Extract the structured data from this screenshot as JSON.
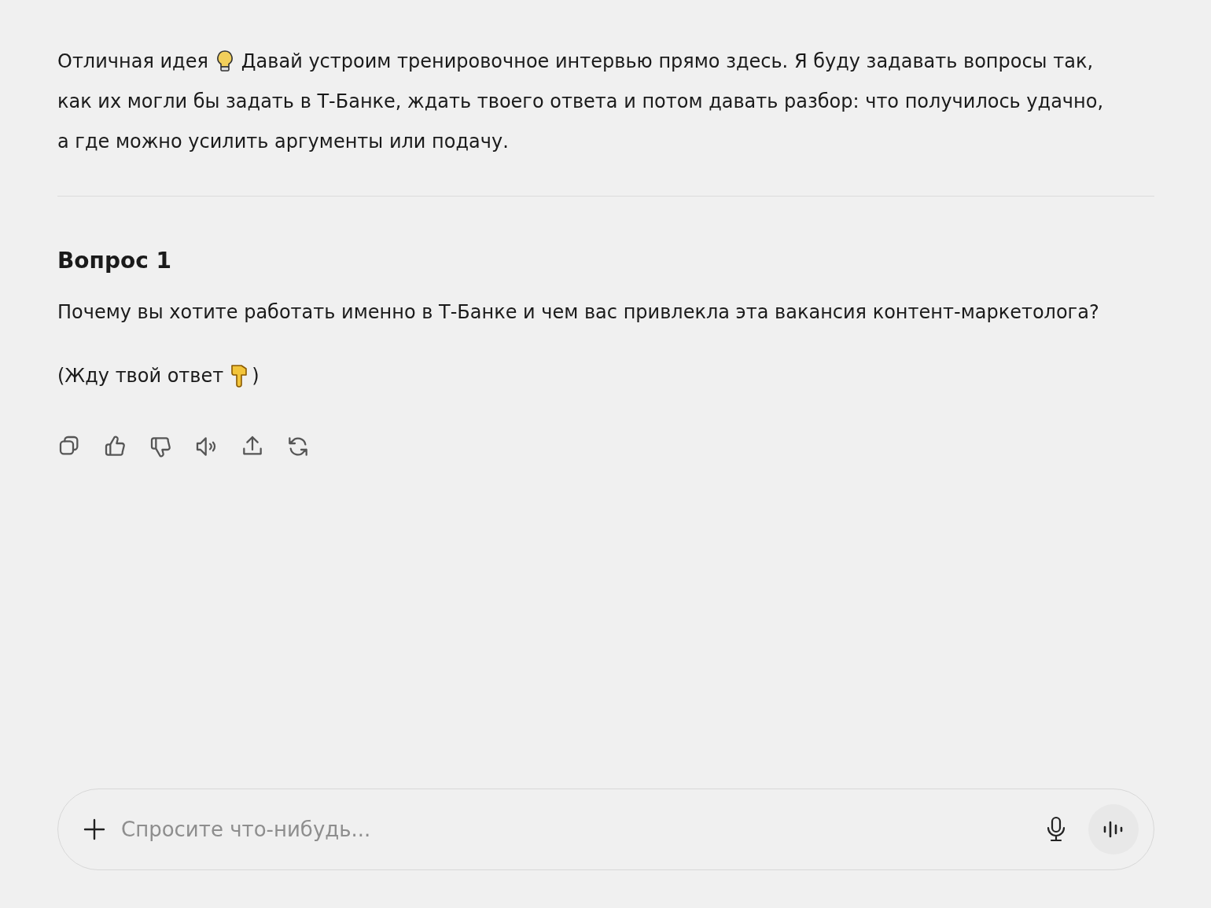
{
  "message": {
    "intro_before": "Отличная идея",
    "intro_lines": [
      "Давай устроим тренировочное интервью прямо здесь. Я буду задавать вопросы так,",
      "как их могли бы задать в Т-Банке, ждать твоего ответа и потом давать разбор: что получилось удачно,",
      "а где можно усилить аргументы или подачу."
    ],
    "heading": "Вопрос 1",
    "question": "Почему вы хотите работать именно в Т-Банке и чем вас привлекла эта вакансия контент-маркетолога?",
    "wait_before": "(Жду твой ответ",
    "wait_after": ")"
  },
  "actions": [
    {
      "kind": "copy"
    },
    {
      "kind": "like"
    },
    {
      "kind": "dislike"
    },
    {
      "kind": "speak"
    },
    {
      "kind": "share"
    },
    {
      "kind": "regenerate"
    }
  ],
  "composer": {
    "placeholder": "Спросите что-нибудь..."
  }
}
